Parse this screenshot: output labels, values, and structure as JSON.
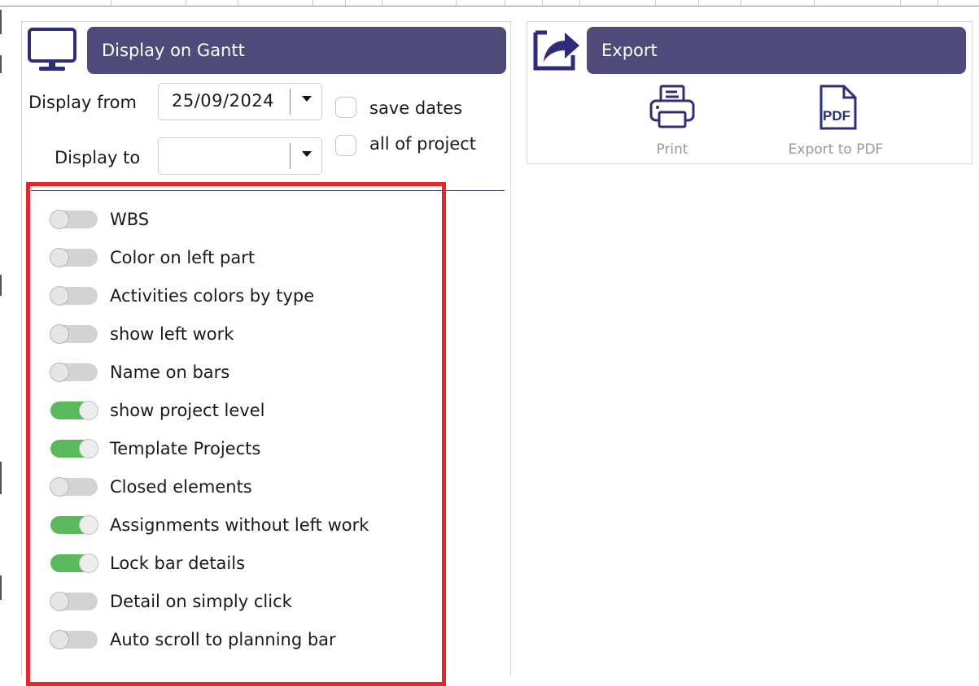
{
  "display_section": {
    "title": "Display on Gantt",
    "icon": "monitor-icon",
    "display_from_label": "Display from",
    "display_from_value": "25/09/2024",
    "display_to_label": "Display to",
    "display_to_value": "",
    "save_dates_label": "save dates",
    "save_dates_checked": false,
    "all_of_project_label": "all of project",
    "all_of_project_checked": false
  },
  "toggles": [
    {
      "label": "WBS",
      "on": false
    },
    {
      "label": "Color on left part",
      "on": false
    },
    {
      "label": "Activities colors by type",
      "on": false
    },
    {
      "label": "show left work",
      "on": false
    },
    {
      "label": "Name on bars",
      "on": false
    },
    {
      "label": "show project level",
      "on": true
    },
    {
      "label": "Template Projects",
      "on": true
    },
    {
      "label": "Closed elements",
      "on": false
    },
    {
      "label": "Assignments without left work",
      "on": true
    },
    {
      "label": "Lock bar details",
      "on": true
    },
    {
      "label": "Detail on simply click",
      "on": false
    },
    {
      "label": "Auto scroll to planning bar",
      "on": false
    }
  ],
  "export_section": {
    "title": "Export",
    "icon": "share-arrow-icon",
    "print_label": "Print",
    "print_icon": "printer-icon",
    "pdf_label": "Export to PDF",
    "pdf_icon": "pdf-file-icon",
    "pdf_icon_text": "PDF"
  },
  "colors": {
    "header_bg": "#4e4a7a",
    "icon_color": "#2f2c78",
    "toggle_on": "#5cb85c",
    "toggle_off": "#d3d3d3",
    "highlight": "#e8262a"
  }
}
